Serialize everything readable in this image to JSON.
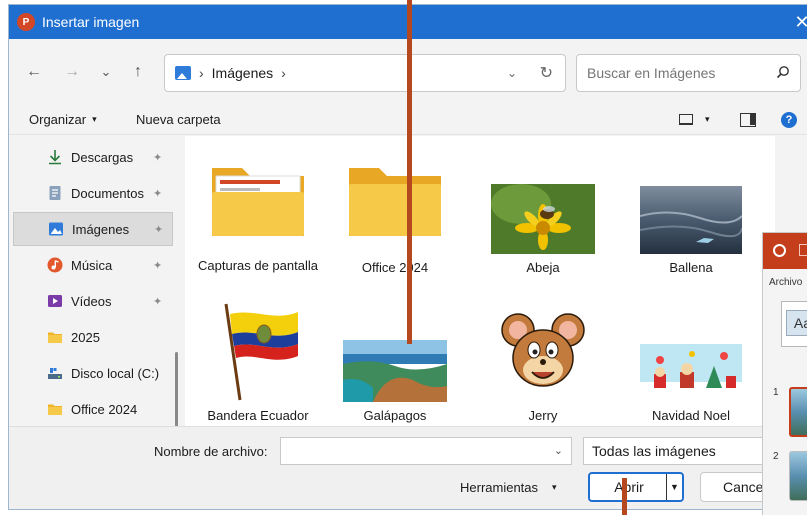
{
  "dialog": {
    "title": "Insertar imagen",
    "close_glyph": "✕"
  },
  "nav": {
    "back": "←",
    "forward": "→",
    "recent": "⌄",
    "up": "↑",
    "path": [
      "Imágenes"
    ],
    "path_sep": "›",
    "dropdown": "⌄",
    "refresh": "↻",
    "search_placeholder": "Buscar en Imágenes"
  },
  "toolbar": {
    "organize_label": "Organizar",
    "new_folder_label": "Nueva carpeta",
    "caret": "▾"
  },
  "sidebar": {
    "items": [
      {
        "label": "Descargas",
        "icon": "download-icon",
        "pinned": true,
        "color": "#2a7a3b"
      },
      {
        "label": "Documentos",
        "icon": "document-icon",
        "pinned": true,
        "color": "#6b7f99"
      },
      {
        "label": "Imágenes",
        "icon": "image-icon",
        "pinned": true,
        "active": true,
        "color": "#2f7bd9"
      },
      {
        "label": "Música",
        "icon": "music-icon",
        "pinned": true,
        "color": "#e2572b"
      },
      {
        "label": "Vídeos",
        "icon": "video-icon",
        "pinned": true,
        "color": "#7a3aa8"
      },
      {
        "label": "2025",
        "icon": "folder-icon",
        "pinned": false,
        "color": "#f0b429"
      },
      {
        "label": "Disco local (C:)",
        "icon": "drive-icon",
        "pinned": false,
        "color": "#4a6b8a"
      },
      {
        "label": "Office 2024",
        "icon": "folder-icon",
        "pinned": false,
        "color": "#f0b429"
      }
    ],
    "pin_glyph": "📌"
  },
  "files": [
    {
      "label": "Capturas de pantalla",
      "kind": "folder-screenshots"
    },
    {
      "label": "Office 2024",
      "kind": "folder"
    },
    {
      "label": "Abeja",
      "kind": "photo-bee"
    },
    {
      "label": "Ballena",
      "kind": "photo-whale"
    },
    {
      "label": "Bandera Ecuador",
      "kind": "photo-flag"
    },
    {
      "label": "Galápagos",
      "kind": "photo-galapagos"
    },
    {
      "label": "Jerry",
      "kind": "photo-jerry"
    },
    {
      "label": "Navidad Noel",
      "kind": "photo-christmas"
    }
  ],
  "footer": {
    "filename_label": "Nombre de archivo:",
    "filename_value": "",
    "filter_value": "Todas las imágenes",
    "tools_label": "Herramientas",
    "open_label": "Abrir",
    "cancel_label": "Cancel"
  },
  "powerpoint": {
    "menu_label": "Archivo",
    "font_sample": "Aa",
    "slide_numbers": [
      "1",
      "2"
    ]
  },
  "colors": {
    "titlebar": "#1f6fd1",
    "accent": "#1f6fd1",
    "annotation": "#b5481f",
    "powerpoint": "#c43e1c"
  }
}
